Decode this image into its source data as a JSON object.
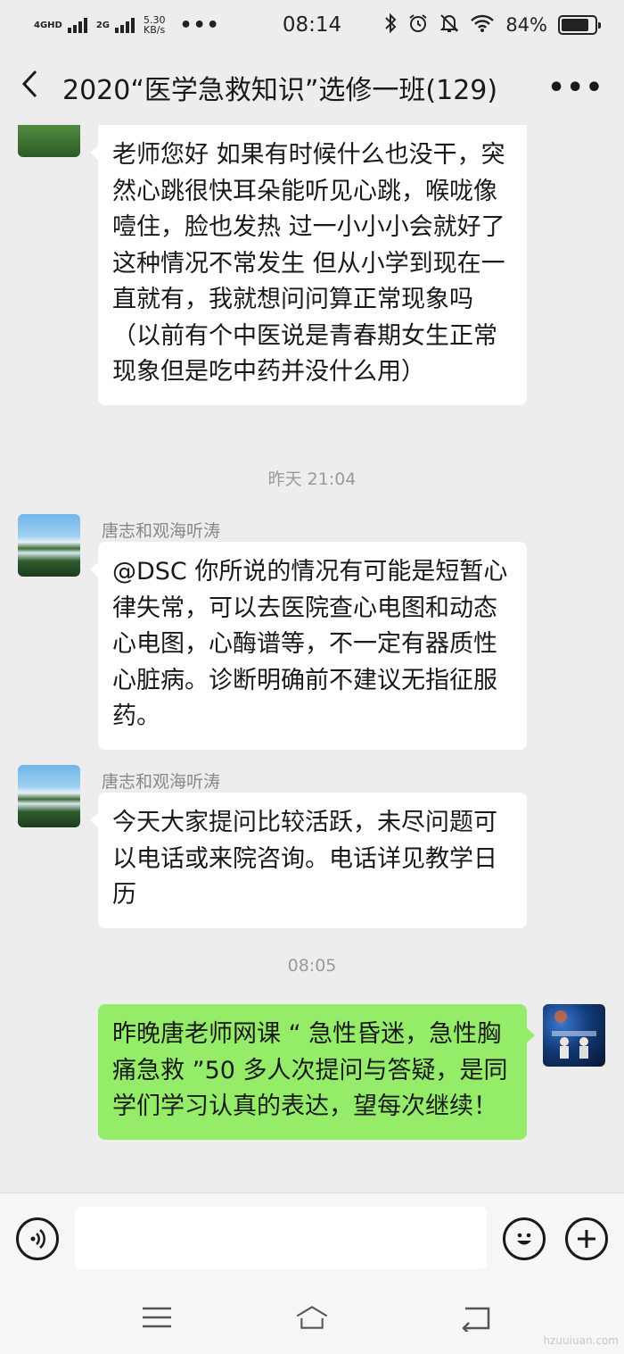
{
  "status_bar": {
    "network_primary": "4GHD",
    "network_secondary": "2G",
    "speed_value": "5.30",
    "speed_unit": "KB/s",
    "overflow": "•••",
    "time": "08:14",
    "battery_percent": "84%",
    "battery_level": 0.84
  },
  "header": {
    "back_icon": "chevron-left-icon",
    "title": "2020“医学急救知识”选修一班(129)",
    "more_label": "•••"
  },
  "messages": [
    {
      "side": "left",
      "avatar": "landscape-avatar",
      "text": "老师您好 如果有时候什么也没干，突然心跳很快耳朵能听见心跳，喉咙像噎住，脸也发热 过一小小小会就好了 这种情况不常发生 但从小学到现在一直就有，我就想问问算正常现象吗（以前有个中医说是青春期女生正常现象但是吃中药并没什么用）"
    },
    {
      "timestamp": "昨天 21:04"
    },
    {
      "side": "left",
      "avatar": "waterfall-avatar",
      "sender": "唐志和观海听涛",
      "text": "@DSC 你所说的情况有可能是短暂心律失常，可以去医院查心电图和动态心电图，心酶谱等，不一定有器质性心脏病。诊断明确前不建议无指征服药。"
    },
    {
      "side": "left",
      "avatar": "waterfall-avatar",
      "sender": "唐志和观海听涛",
      "text": "今天大家提问比较活跃，未尽问题可以电话或来院咨询。电话详见教学日历"
    },
    {
      "timestamp": "08:05"
    },
    {
      "side": "right",
      "avatar": "stage-avatar",
      "text": "昨晚唐老师网课 “ 急性昏迷，急性胸痛急救 ”50 多人次提问与答疑，是同学们学习认真的表达，望每次继续！"
    }
  ],
  "input_bar": {
    "voice_icon": "voice-icon",
    "emoji_icon": "emoji-icon",
    "plus_icon": "plus-icon",
    "text_value": ""
  },
  "nav_bar": {
    "menu_icon": "menu-icon",
    "home_icon": "home-icon",
    "back_icon": "back-icon"
  },
  "watermark": "hzuuiuan.com",
  "colors": {
    "background": "#ededed",
    "bubble_other": "#ffffff",
    "bubble_self": "#95ec69",
    "meta_text": "#9a9a9a"
  }
}
